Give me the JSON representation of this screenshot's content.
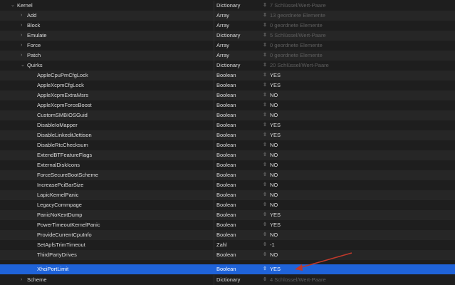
{
  "plist": {
    "kernel": {
      "key": "Kernel",
      "type": "Dictionary",
      "value": "7 Schlüssel/Wert-Paare"
    },
    "children": [
      {
        "key": "Add",
        "type": "Array",
        "value": "13 geordnete Elemente"
      },
      {
        "key": "Block",
        "type": "Array",
        "value": "0 geordnete Elemente"
      },
      {
        "key": "Emulate",
        "type": "Dictionary",
        "value": "5 Schlüssel/Wert-Paare"
      },
      {
        "key": "Force",
        "type": "Array",
        "value": "0 geordnete Elemente"
      },
      {
        "key": "Patch",
        "type": "Array",
        "value": "0 geordnete Elemente"
      }
    ],
    "quirks": {
      "key": "Quirks",
      "type": "Dictionary",
      "value": "20 Schlüssel/Wert-Paare"
    },
    "quirk_items": [
      {
        "key": "AppleCpuPmCfgLock",
        "type": "Boolean",
        "value": "YES"
      },
      {
        "key": "AppleXcpmCfgLock",
        "type": "Boolean",
        "value": "YES"
      },
      {
        "key": "AppleXcpmExtraMsrs",
        "type": "Boolean",
        "value": "NO"
      },
      {
        "key": "AppleXcpmForceBoost",
        "type": "Boolean",
        "value": "NO"
      },
      {
        "key": "CustomSMBIOSGuid",
        "type": "Boolean",
        "value": "NO"
      },
      {
        "key": "DisableIoMapper",
        "type": "Boolean",
        "value": "YES"
      },
      {
        "key": "DisableLinkeditJettison",
        "type": "Boolean",
        "value": "YES"
      },
      {
        "key": "DisableRtcChecksum",
        "type": "Boolean",
        "value": "NO"
      },
      {
        "key": "ExtendBTFeatureFlags",
        "type": "Boolean",
        "value": "NO"
      },
      {
        "key": "ExternalDiskIcons",
        "type": "Boolean",
        "value": "NO"
      },
      {
        "key": "ForceSecureBootScheme",
        "type": "Boolean",
        "value": "NO"
      },
      {
        "key": "IncreasePciBarSize",
        "type": "Boolean",
        "value": "NO"
      },
      {
        "key": "LapicKernelPanic",
        "type": "Boolean",
        "value": "NO"
      },
      {
        "key": "LegacyCommpage",
        "type": "Boolean",
        "value": "NO"
      },
      {
        "key": "PanicNoKextDump",
        "type": "Boolean",
        "value": "YES"
      },
      {
        "key": "PowerTimeoutKernelPanic",
        "type": "Boolean",
        "value": "YES"
      },
      {
        "key": "ProvideCurrentCpuInfo",
        "type": "Boolean",
        "value": "NO"
      },
      {
        "key": "SetApfsTrimTimeout",
        "type": "Zahl",
        "value": "-1"
      },
      {
        "key": "ThirdPartyDrives",
        "type": "Boolean",
        "value": "NO"
      },
      {
        "key": "XhciPortLimit",
        "type": "Boolean",
        "value": "YES"
      }
    ],
    "scheme": {
      "key": "Scheme",
      "type": "Dictionary",
      "value": "4 Schlüssel/Wert-Paare"
    }
  },
  "icons": {
    "expanded": "chevron-down-icon",
    "collapsed": "chevron-right-icon",
    "stepper": "up-down-stepper-icon"
  },
  "colors": {
    "selection": "#1f63d9",
    "annotation_arrow": "#c0392b"
  }
}
